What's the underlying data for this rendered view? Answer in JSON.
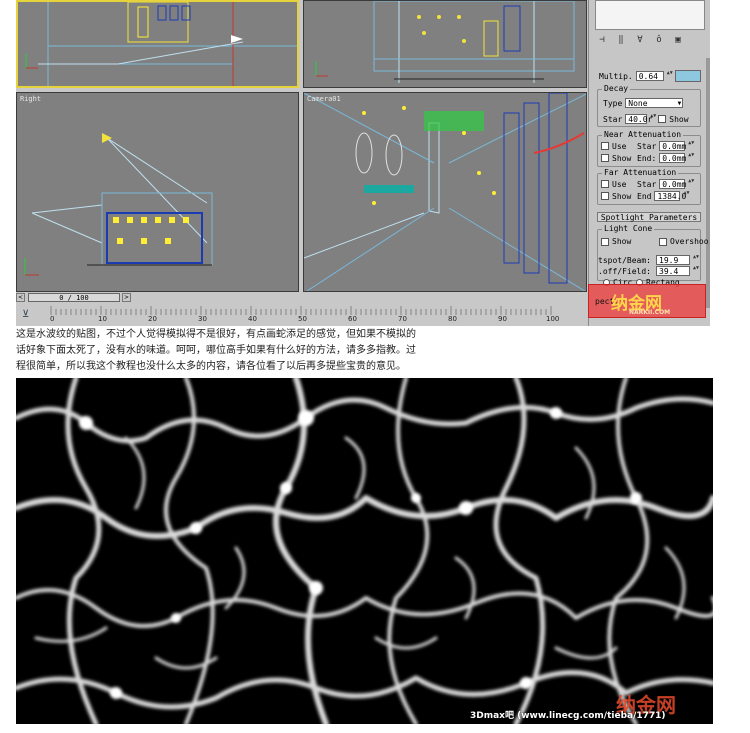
{
  "viewports": {
    "top_left": "",
    "top_right": "",
    "right": "Right",
    "perspective": "Camera01"
  },
  "command_panel": {
    "multiplier_label": "Multip.",
    "multiplier_value": "0.64",
    "multiplier_color": "#8ec8e0",
    "decay_title": "Decay",
    "type_label": "Type",
    "type_value": "None",
    "start_label": "Star",
    "start_value": "40.0r",
    "show_label": "Show",
    "near_title": "Near Attenuation",
    "near_use": "Use",
    "near_show": "Show",
    "near_start_label": "Star",
    "near_start_value": "0.0mm",
    "near_end_label": "End:",
    "near_end_value": "0.0mm",
    "far_title": "Far Attenuation",
    "far_use": "Use",
    "far_show": "Show",
    "far_start_label": "Star",
    "far_start_value": "0.0mm",
    "far_end_label": "End",
    "far_end_value": "1384.0",
    "spot_title": "Spotlight Parameters",
    "cone_title": "Light Cone",
    "cone_show": "Show",
    "overshoot": "Overshoo",
    "hotspot_label": "tspot/Beam:",
    "hotspot_value": "19.9",
    "falloff_label": ".off/Field:",
    "falloff_value": "39.4",
    "circle_label": "Circ",
    "rect_label": "Rectang",
    "aspect_label": "pect:"
  },
  "watermark_top": {
    "logo": "纳金网",
    "url": "NARKII.COM"
  },
  "time_slider": {
    "frame": "0 / 100"
  },
  "track": {
    "ticks": [
      "0",
      "10",
      "20",
      "30",
      "40",
      "50",
      "60",
      "70",
      "80",
      "90",
      "100"
    ]
  },
  "caption": {
    "line1": "这是水波纹的贴图，不过个人觉得模拟得不是很好，有点画蛇添足的感觉，但如果不模拟的",
    "line2": "话好象下面太死了，没有水的味道。呵呵，哪位高手如果有什么好的方法，请多多指教。过",
    "line3": "程很简单，所以我这个教程也没什么太多的内容，请各位看了以后再多提些宝贵的意见。"
  },
  "texture": {
    "watermark": "纳金网",
    "credit": "3Dmax吧 (www.linecg.com/tieba/1771)"
  }
}
